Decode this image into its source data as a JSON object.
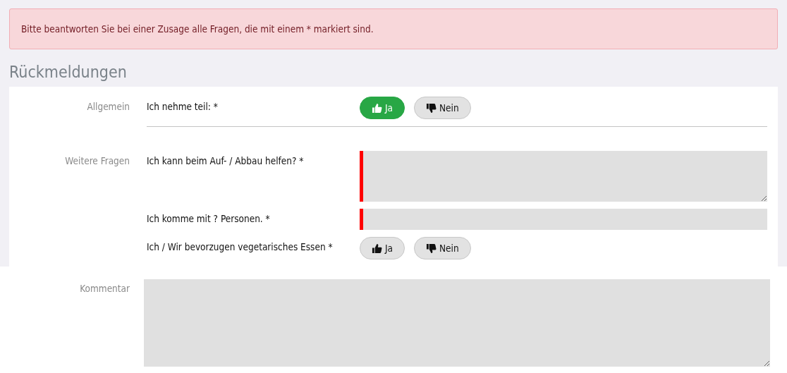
{
  "alert": "Bitte beantworten Sie bei einer Zusage alle Fragen, die mit einem * markiert sind.",
  "heading": "Rückmeldungen",
  "sections": [
    {
      "label": "Allgemein",
      "divider": true,
      "questions": [
        {
          "kind": "yesno",
          "text": "Ich nehme teil: *",
          "yes": {
            "label": "Ja",
            "selected": true
          },
          "no": {
            "label": "Nein",
            "selected": false
          }
        }
      ]
    },
    {
      "label": "Weitere Fragen",
      "divider": false,
      "questions": [
        {
          "kind": "textarea",
          "text": "Ich kann beim Auf- / Abbau helfen? *",
          "invalid": true
        },
        {
          "kind": "text",
          "text": "Ich komme mit ? Personen. *",
          "invalid": true
        },
        {
          "kind": "yesno",
          "text": "Ich / Wir bevorzugen vegetarisches Essen *",
          "yes": {
            "label": "Ja",
            "selected": false
          },
          "no": {
            "label": "Nein",
            "selected": false
          }
        }
      ]
    }
  ],
  "comment": {
    "label": "Kommentar"
  }
}
